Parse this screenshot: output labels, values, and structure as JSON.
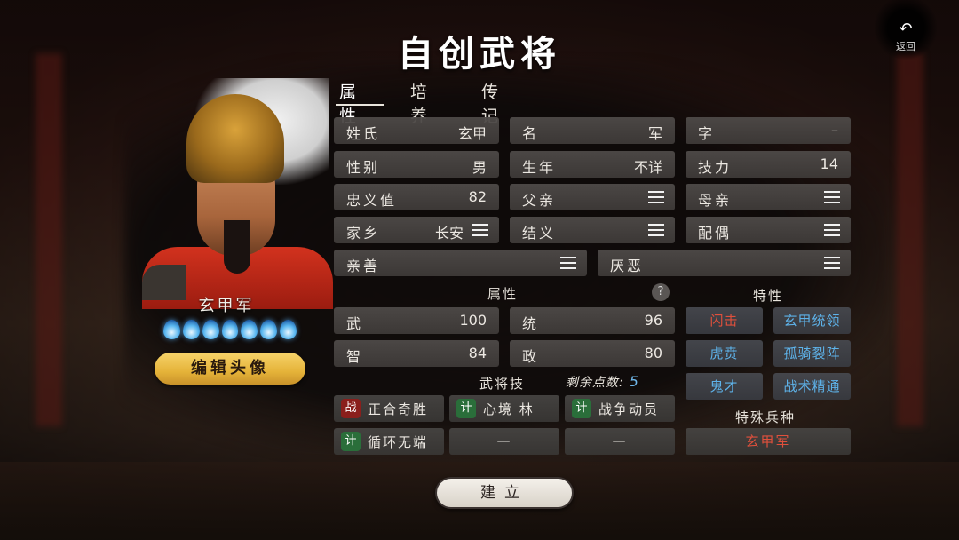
{
  "title": "自创武将",
  "back_label": "返回",
  "portrait": {
    "name": "玄甲军",
    "flame_count": 7,
    "edit_label": "编辑头像"
  },
  "tabs": [
    {
      "label": "属性",
      "active": true
    },
    {
      "label": "培养",
      "active": false
    },
    {
      "label": "传记",
      "active": false
    }
  ],
  "info": {
    "surname_label": "姓氏",
    "surname_value": "玄甲",
    "given_label": "名",
    "given_value": "军",
    "courtesy_label": "字",
    "courtesy_value": "–",
    "gender_label": "性别",
    "gender_value": "男",
    "birth_label": "生年",
    "birth_value": "不详",
    "skill_power_label": "技力",
    "skill_power_value": "14",
    "loyalty_label": "忠义值",
    "loyalty_value": "82",
    "father_label": "父亲",
    "mother_label": "母亲",
    "hometown_label": "家乡",
    "hometown_value": "长安",
    "sworn_label": "结义",
    "spouse_label": "配偶",
    "like_label": "亲善",
    "dislike_label": "厌恶"
  },
  "attributes": {
    "title": "属性",
    "help": "?",
    "war_label": "武",
    "war_value": "100",
    "lead_label": "统",
    "lead_value": "96",
    "int_label": "智",
    "int_value": "84",
    "pol_label": "政",
    "pol_value": "80"
  },
  "traits": {
    "title": "特性",
    "items": [
      {
        "label": "闪击",
        "color": "red"
      },
      {
        "label": "玄甲统领",
        "color": "blue"
      },
      {
        "label": "虎贲",
        "color": "blue"
      },
      {
        "label": "孤骑裂阵",
        "color": "blue"
      },
      {
        "label": "鬼才",
        "color": "blue"
      },
      {
        "label": "战术精通",
        "color": "blue"
      }
    ]
  },
  "skills": {
    "title": "武将技",
    "points_label": "剩余点数:",
    "points_value": "5",
    "items": [
      {
        "badge": "战",
        "name": "正合奇胜"
      },
      {
        "badge": "计",
        "name": "心境 林"
      },
      {
        "badge": "计",
        "name": "战争动员"
      },
      {
        "badge": "计",
        "name": "循环无端"
      },
      {
        "badge": "",
        "name": "—"
      },
      {
        "badge": "",
        "name": "—"
      }
    ]
  },
  "special_unit": {
    "title": "特殊兵种",
    "value": "玄甲军"
  },
  "create_label": "建立",
  "colors": {
    "accent_red": "#e0503c",
    "accent_blue": "#5eb3ea",
    "gold": "#e5b339"
  }
}
